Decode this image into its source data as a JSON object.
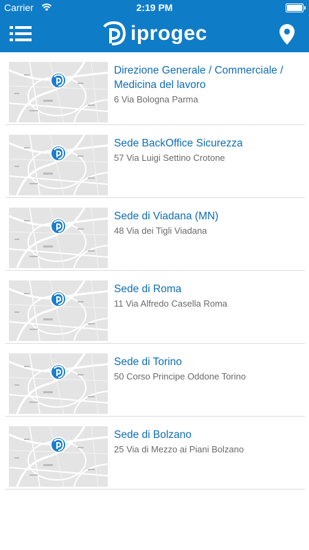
{
  "status": {
    "carrier": "Carrier",
    "time": "2:19 PM"
  },
  "header": {
    "brand": "iprogec"
  },
  "locations": [
    {
      "title": "Direzione Generale / Commerciale / Medicina del lavoro",
      "address": "6 Via Bologna Parma"
    },
    {
      "title": "Sede BackOffice Sicurezza",
      "address": "57 Via Luigi Settino Crotone"
    },
    {
      "title": "Sede di Viadana (MN)",
      "address": "48 Via dei Tigli Viadana"
    },
    {
      "title": "Sede di Roma",
      "address": "11 Via Alfredo Casella Roma"
    },
    {
      "title": "Sede di Torino",
      "address": "50 Corso Principe Oddone Torino"
    },
    {
      "title": "Sede di Bolzano",
      "address": "25 Via di Mezzo ai Piani Bolzano"
    }
  ],
  "colors": {
    "brand_blue": "#0f7cc8",
    "link_blue": "#0e6db5"
  }
}
